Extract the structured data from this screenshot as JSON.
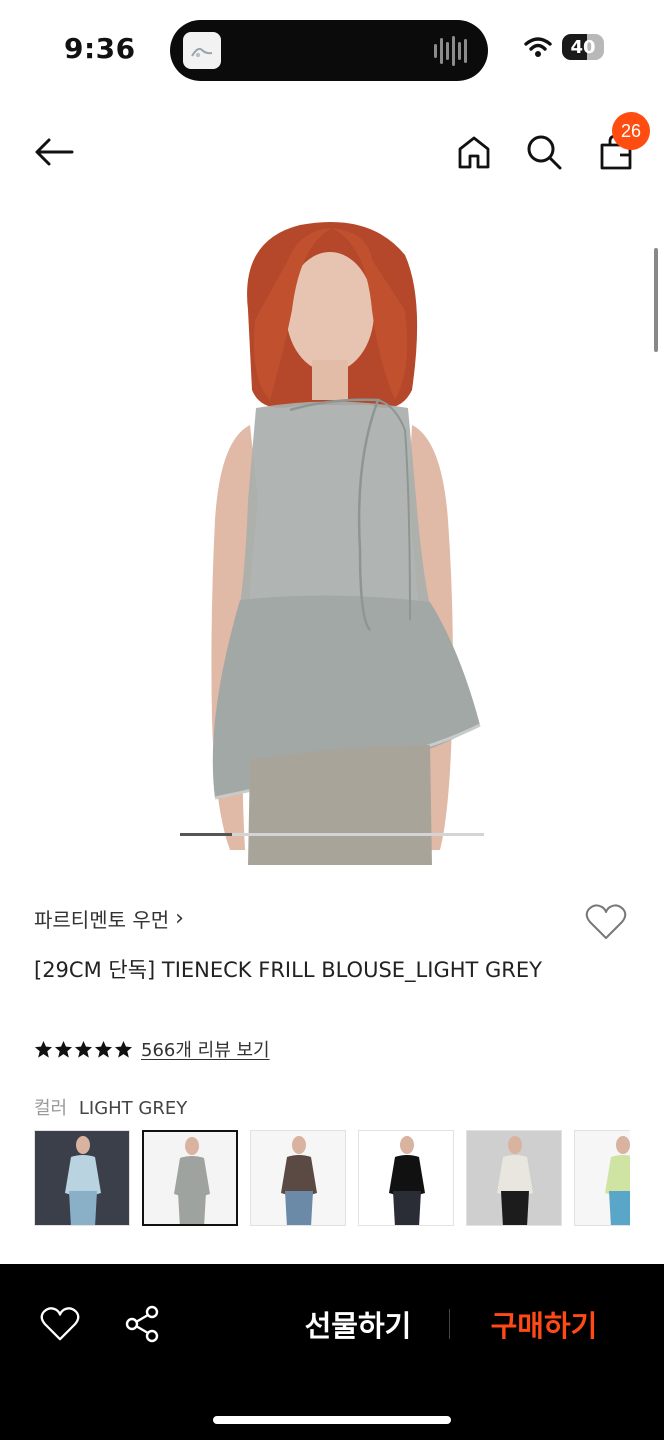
{
  "status_bar": {
    "time": "9:36",
    "battery": "40"
  },
  "header": {
    "cart_count": "26"
  },
  "product": {
    "brand": "파르티멘토 우먼",
    "brand_chevron": "›",
    "title": "[29CM 단독] TIENECK FRILL BLOUSE_LIGHT GREY",
    "rating_stars": 5,
    "reviews_link": "566개 리뷰 보기",
    "color_label": "컬러",
    "color_value": "LIGHT GREY",
    "carousel_progress": 0.17
  },
  "color_options": [
    {
      "name": "swatch-1",
      "bg": "#3a3f4a",
      "top": "#b9d4e0",
      "bottom": "#8ab0c8"
    },
    {
      "name": "swatch-2",
      "bg": "#f4f4f4",
      "top": "#9ea39f",
      "bottom": "#9ea39f"
    },
    {
      "name": "swatch-3",
      "bg": "#f6f6f6",
      "top": "#5a4a43",
      "bottom": "#6b8aa8"
    },
    {
      "name": "swatch-4",
      "bg": "#ffffff",
      "top": "#111111",
      "bottom": "#2a2d36"
    },
    {
      "name": "swatch-5",
      "bg": "#cfcfcf",
      "top": "#e9e6e0",
      "bottom": "#1c1c1c"
    },
    {
      "name": "swatch-6",
      "bg": "#f6f6f6",
      "top": "#cfe3a3",
      "bottom": "#5aa6c9"
    }
  ],
  "bottom_bar": {
    "gift_label": "선물하기",
    "buy_label": "구매하기"
  },
  "colors": {
    "accent": "#ff4d12",
    "buy": "#ff4a17",
    "bar": "#000000"
  }
}
